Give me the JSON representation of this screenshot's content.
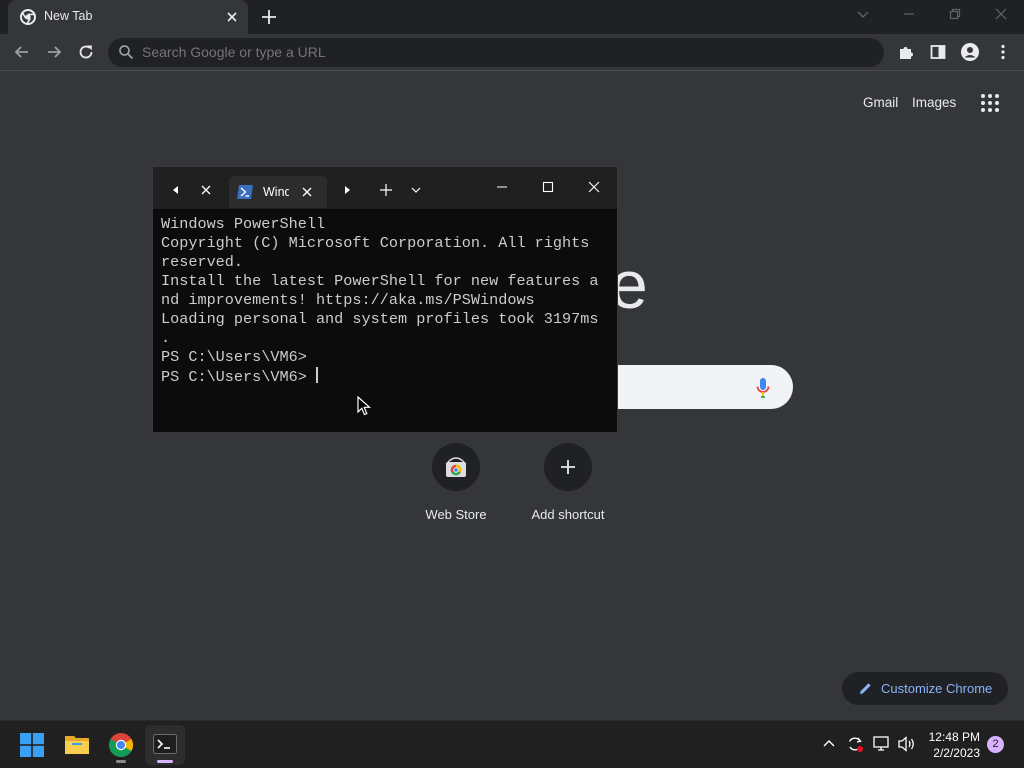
{
  "browser": {
    "tab_title": "New Tab",
    "omnibox_placeholder": "Search Google or type a URL"
  },
  "ntp": {
    "links": {
      "gmail": "Gmail",
      "images": "Images"
    },
    "logo_fragment": "e",
    "shortcuts": [
      {
        "label": "Web Store",
        "icon": "web-store-icon"
      },
      {
        "label": "Add shortcut",
        "icon": "plus-icon"
      }
    ],
    "customize_label": "Customize Chrome"
  },
  "terminal": {
    "tab_title": "Windows PowerShell",
    "lines": [
      "Windows PowerShell",
      "Copyright (C) Microsoft Corporation. All rights",
      "reserved.",
      "",
      "Install the latest PowerShell for new features a",
      "nd improvements! https://aka.ms/PSWindows",
      "",
      "Loading personal and system profiles took 3197ms",
      ".",
      "PS C:\\Users\\VM6>",
      "PS C:\\Users\\VM6> "
    ]
  },
  "taskbar": {
    "time": "12:48 PM",
    "date": "2/2/2023",
    "notification_count": "2"
  },
  "colors": {
    "chrome_frame": "#202124",
    "chrome_toolbar": "#35363a",
    "terminal_bg": "#0c0c0c",
    "accent_link": "#8ab4f8",
    "taskbar_bg": "#202020"
  }
}
